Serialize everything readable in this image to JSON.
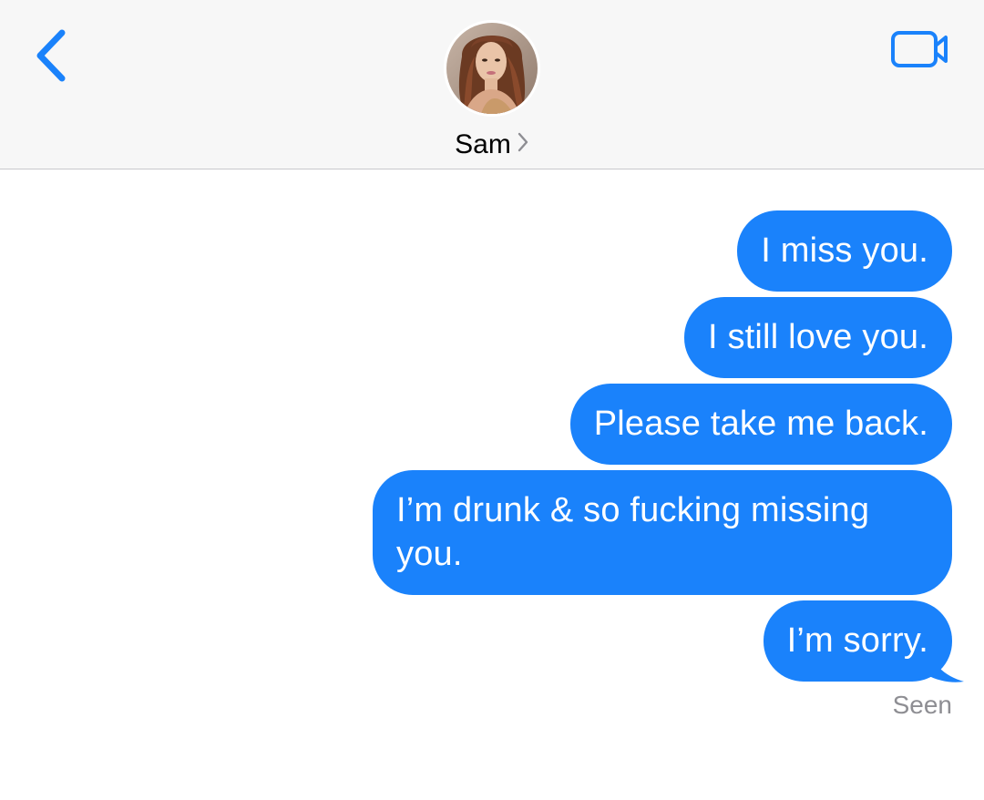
{
  "header": {
    "back_icon": "chevron-left-icon",
    "video_icon": "video-camera-icon",
    "contact_name": "Sam",
    "contact_chevron_icon": "chevron-right-icon"
  },
  "colors": {
    "accent": "#1a82fb",
    "bubble_text": "#ffffff",
    "header_bg": "#f7f7f7",
    "status_text": "#8e8e93"
  },
  "messages": [
    {
      "text": "I miss you.",
      "direction": "sent"
    },
    {
      "text": "I still love you.",
      "direction": "sent"
    },
    {
      "text": "Please take me back.",
      "direction": "sent"
    },
    {
      "text": "I’m drunk & so fucking missing you.",
      "direction": "sent"
    },
    {
      "text": "I’m sorry.",
      "direction": "sent"
    }
  ],
  "status": {
    "read_receipt": "Seen"
  }
}
